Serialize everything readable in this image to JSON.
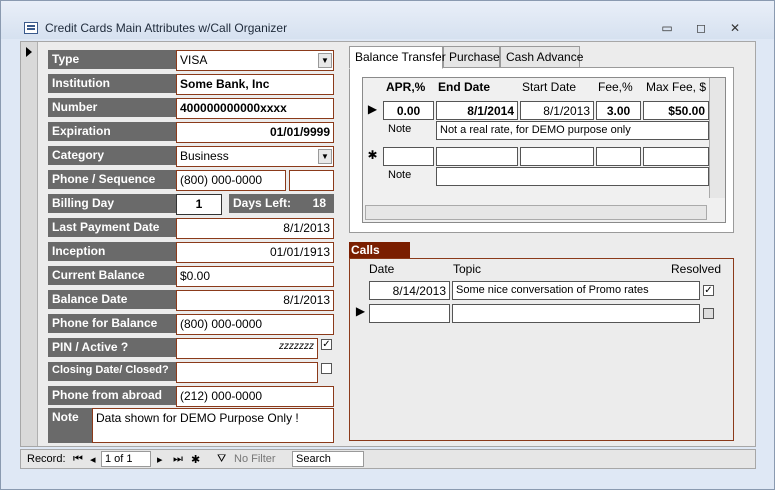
{
  "window": {
    "title": "Credit Cards Main Attributes w/Call Organizer",
    "minimize": "▭",
    "restore": "◻",
    "close": "✕"
  },
  "form": {
    "type": {
      "label": "Type",
      "value": "VISA"
    },
    "institution": {
      "label": "Institution",
      "value": "Some Bank, Inc"
    },
    "number": {
      "label": "Number",
      "value": "400000000000xxxx"
    },
    "expiration": {
      "label": "Expiration",
      "value": "01/01/9999"
    },
    "category": {
      "label": "Category",
      "value": "Business"
    },
    "phone_sequence": {
      "label": "Phone / Sequence",
      "value": "(800) 000-0000",
      "sequence": ""
    },
    "billing_day": {
      "label": "Billing Day",
      "value": "1"
    },
    "days_left": {
      "label": "Days Left:",
      "value": "18"
    },
    "last_payment_date": {
      "label": "Last Payment Date",
      "value": "8/1/2013"
    },
    "inception": {
      "label": "Inception",
      "value": "01/01/1913"
    },
    "current_balance": {
      "label": "Current Balance",
      "value": "$0.00"
    },
    "balance_date": {
      "label": "Balance Date",
      "value": "8/1/2013"
    },
    "phone_for_balance": {
      "label": "Phone for Balance",
      "value": "(800) 000-0000"
    },
    "pin_active": {
      "label": "PIN / Active ?",
      "value": "zzzzzzz",
      "checked": true
    },
    "closing": {
      "label": "Closing Date/ Closed?",
      "value": "",
      "checked": false
    },
    "phone_abroad": {
      "label": "Phone from abroad",
      "value": "(212) 000-0000"
    },
    "note": {
      "label": "Note",
      "value": "Data shown for DEMO Purpose Only !"
    }
  },
  "tabs": [
    "Balance Transfer",
    "Purchase",
    "Cash Advance"
  ],
  "balance_transfer": {
    "headers": {
      "apr": "APR,%",
      "end_date": "End Date",
      "start_date": "Start Date",
      "fee": "Fee,%",
      "max_fee": "Max Fee, $"
    },
    "row": {
      "apr": "0.00",
      "end_date": "8/1/2014",
      "start_date": "8/1/2013",
      "fee": "3.00",
      "max_fee": "$50.00",
      "note_label": "Note",
      "note": "Not a real rate, for DEMO purpose only"
    },
    "new_row": {
      "marker": "✱",
      "note_label": "Note"
    }
  },
  "calls": {
    "label": "Calls",
    "headers": {
      "date": "Date",
      "topic": "Topic",
      "resolved": "Resolved"
    },
    "rows": [
      {
        "date": "8/14/2013",
        "topic": "Some nice conversation of Promo rates",
        "resolved": true
      }
    ]
  },
  "navigation": {
    "record_label": "Record:",
    "record_value": "1 of 1",
    "filter": "No Filter",
    "search": "Search"
  }
}
